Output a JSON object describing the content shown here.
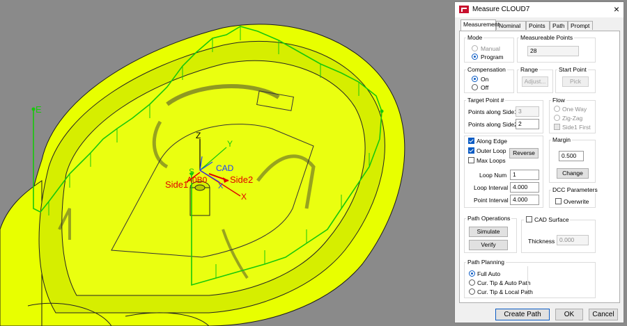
{
  "viewport": {
    "labels": {
      "e": "E",
      "z": "Z",
      "y": "Y",
      "cad": "CAD",
      "s": "S",
      "side1": "Side1",
      "aob0": "A0B0",
      "side2": "Side2",
      "x": "X",
      "x2": "X"
    },
    "colors": {
      "background": "#8a8a8a",
      "part": "#e8ff00",
      "path": "#17c80a",
      "side": "#e00000"
    }
  },
  "dialog": {
    "title": "Measure CLOUD7",
    "close": "×",
    "tabs": [
      "Measurement",
      "Nominal",
      "Points",
      "Path",
      "Prompt"
    ],
    "mode": {
      "label": "Mode",
      "manual": "Manual",
      "program": "Program"
    },
    "measureable": {
      "label": "Measureable Points",
      "value": "28"
    },
    "compensation": {
      "label": "Compensation",
      "on": "On",
      "off": "Off"
    },
    "range": {
      "label": "Range",
      "button": "Adjust..."
    },
    "start_point": {
      "label": "Start Point",
      "button": "Pick"
    },
    "target": {
      "label": "Target Point #",
      "side1_label": "Points along Side1",
      "side1_value": "3",
      "side2_label": "Points along Side2",
      "side2_value": "2"
    },
    "flow": {
      "label": "Flow",
      "one_way": "One Way",
      "zig_zag": "Zig-Zag",
      "side1_first": "Side1 First"
    },
    "edge": {
      "along_edge": "Along Edge",
      "outer_loop": "Outer Loop",
      "max_loops": "Max Loops",
      "reverse": "Reverse",
      "loop_num_label": "Loop Num",
      "loop_num": "1",
      "loop_interval_label": "Loop Interval",
      "loop_interval": "4.000",
      "point_interval_label": "Point Interval",
      "point_interval": "4.000"
    },
    "margin": {
      "label": "Margin",
      "value": "0.500",
      "button": "Change"
    },
    "dcc": {
      "label": "DCC Parameters",
      "overwrite": "Overwrite"
    },
    "path_ops": {
      "label": "Path Operations",
      "simulate": "Simulate",
      "verify": "Verify"
    },
    "cad_surface": {
      "label": "CAD Surface",
      "thickness_label": "Thickness",
      "thickness_value": "0.000"
    },
    "planning": {
      "label": "Path Planning",
      "full_auto": "Full Auto",
      "tip_auto": "Cur. Tip & Auto Path",
      "tip_local": "Cur. Tip & Local Path"
    },
    "footer": {
      "create": "Create Path",
      "ok": "OK",
      "cancel": "Cancel"
    },
    "accent": "#0a5bc4"
  }
}
